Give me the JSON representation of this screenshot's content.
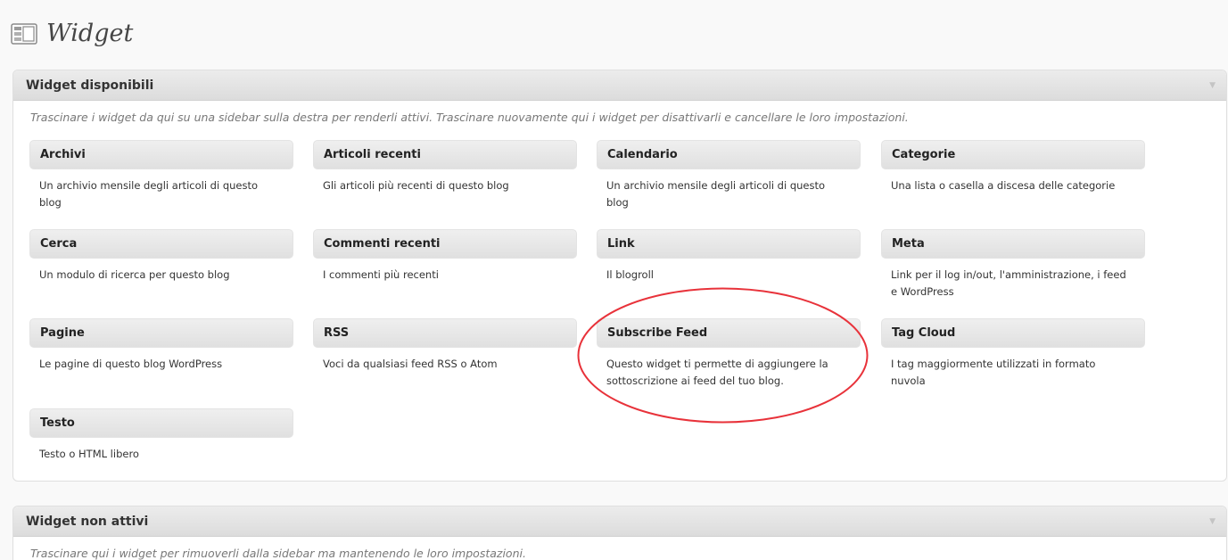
{
  "page": {
    "title": "Widget"
  },
  "available": {
    "title": "Widget disponibili",
    "description": "Trascinare i widget da qui su una sidebar sulla destra per renderli attivi. Trascinare nuovamente qui i widget per disattivarli e cancellare le loro impostazioni.",
    "widgets": [
      {
        "name": "Archivi",
        "desc": "Un archivio mensile degli articoli di questo blog"
      },
      {
        "name": "Articoli recenti",
        "desc": "Gli articoli più recenti di questo blog"
      },
      {
        "name": "Calendario",
        "desc": "Un archivio mensile degli articoli di questo blog"
      },
      {
        "name": "Categorie",
        "desc": "Una lista o casella a discesa delle categorie"
      },
      {
        "name": "Cerca",
        "desc": "Un modulo di ricerca per questo blog"
      },
      {
        "name": "Commenti recenti",
        "desc": "I commenti più recenti"
      },
      {
        "name": "Link",
        "desc": "Il blogroll"
      },
      {
        "name": "Meta",
        "desc": "Link per il log in/out, l'amministrazione, i feed e WordPress"
      },
      {
        "name": "Pagine",
        "desc": "Le pagine di questo blog WordPress"
      },
      {
        "name": "RSS",
        "desc": "Voci da qualsiasi feed RSS o Atom"
      },
      {
        "name": "Subscribe Feed",
        "desc": "Questo widget ti permette di aggiungere la sottoscrizione ai feed del tuo blog."
      },
      {
        "name": "Tag Cloud",
        "desc": "I tag maggiormente utilizzati in formato nuvola"
      },
      {
        "name": "Testo",
        "desc": "Testo o HTML libero"
      }
    ]
  },
  "inactive": {
    "title": "Widget non attivi",
    "description": "Trascinare qui i widget per rimuoverli dalla sidebar ma mantenendo le loro impostazioni."
  },
  "colors": {
    "highlight": "#e8323a",
    "panel_header": "#e4e4e4",
    "widget_title_bg": "#e8e8e8"
  },
  "icons": {
    "header": "widgets-layout-icon",
    "collapse": "triangle-down-icon"
  }
}
